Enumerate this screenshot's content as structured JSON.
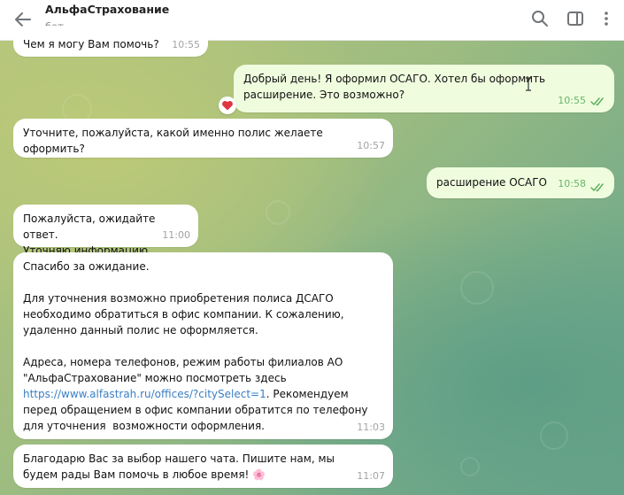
{
  "header": {
    "title": "АльфаСтрахование",
    "subtitle": "бот"
  },
  "messages": [
    {
      "id": "m0",
      "direction": "in",
      "text": "Чем я могу Вам помочь?",
      "time": "10:55"
    },
    {
      "id": "m1",
      "direction": "out",
      "text": "Добрый день! Я оформил ОСАГО. Хотел бы оформить расширение. Это возможно?",
      "time": "10:55",
      "reaction": "heart"
    },
    {
      "id": "m2",
      "direction": "in",
      "text": "Уточните, пожалуйста, какой именно полис желаете оформить?",
      "time": "10:57"
    },
    {
      "id": "m3",
      "direction": "out",
      "text": "расширение ОСАГО",
      "time": "10:58"
    },
    {
      "id": "m4",
      "direction": "in",
      "text": "Пожалуйста, ожидайте ответ.\nУточняю информацию.",
      "time": "11:00"
    },
    {
      "id": "m5",
      "direction": "in",
      "p1": "Спасибо за ожидание.",
      "p2": "Для уточнения возможно приобретения полиса ДСАГО необходимо обратиться в офис компании. К сожалению, удаленно данный полис не оформляется.",
      "p3a": "Адреса, номера телефонов, режим работы филиалов АО \"АльфаСтрахование\" можно посмотреть здесь ",
      "link": "https://www.alfastrah.ru/offices/?citySelect=1",
      "p3b": ". Рекомендуем перед обращением в офис компании обратится по телефону для уточнения  возможности оформления.",
      "time": "11:03"
    },
    {
      "id": "m6",
      "direction": "in",
      "text": "Благодарю Вас за выбор нашего чата. Пишите нам, мы будем рады Вам помочь в любое время!",
      "emoji": "🌸",
      "time": "11:07"
    }
  ],
  "colors": {
    "incoming": "#ffffff",
    "outgoing": "#effdde",
    "link": "#3a7fc3",
    "read_ticks": "#5fae5f"
  },
  "icons": [
    "back-arrow-icon",
    "search-icon",
    "sidebar-toggle-icon",
    "more-vertical-icon",
    "double-check-icon",
    "heart-reaction-icon",
    "text-cursor-icon"
  ]
}
